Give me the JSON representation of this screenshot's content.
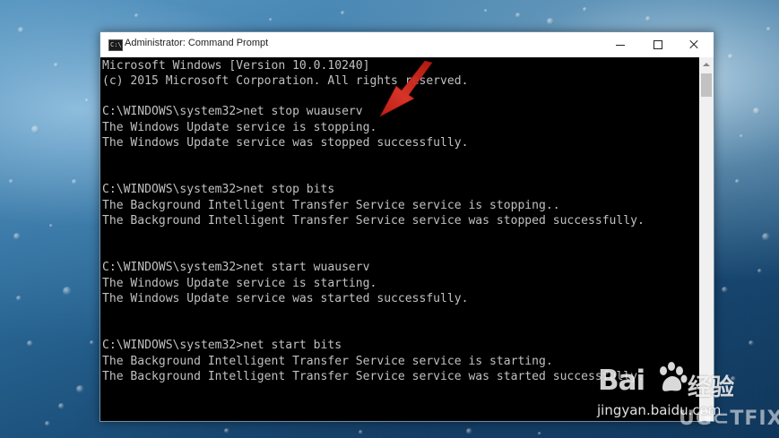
{
  "window": {
    "title": "Administrator: Command Prompt",
    "icon": "cmd-icon",
    "icon_glyph": "C:\\"
  },
  "console": {
    "lines": [
      "Microsoft Windows [Version 10.0.10240]",
      "(c) 2015 Microsoft Corporation. All rights reserved.",
      "",
      "C:\\WINDOWS\\system32>net stop wuauserv",
      "The Windows Update service is stopping.",
      "The Windows Update service was stopped successfully.",
      "",
      "",
      "C:\\WINDOWS\\system32>net stop bits",
      "The Background Intelligent Transfer Service service is stopping..",
      "The Background Intelligent Transfer Service service was stopped successfully.",
      "",
      "",
      "C:\\WINDOWS\\system32>net start wuauserv",
      "The Windows Update service is starting.",
      "The Windows Update service was started successfully.",
      "",
      "",
      "C:\\WINDOWS\\system32>net start bits",
      "The Background Intelligent Transfer Service service is starting.",
      "The Background Intelligent Transfer Service service was started successfully."
    ]
  },
  "annotation": {
    "arrow_color": "#d42a1e"
  },
  "watermarks": {
    "baidu_latin": "Bai",
    "baidu_cn": "经验",
    "baidu_url": "jingyan.baidu.com",
    "ugetfix": "UG⊂TFIX"
  },
  "colors": {
    "console_bg": "#000000",
    "console_text": "#c0c0c0",
    "titlebar_bg": "#ffffff"
  }
}
